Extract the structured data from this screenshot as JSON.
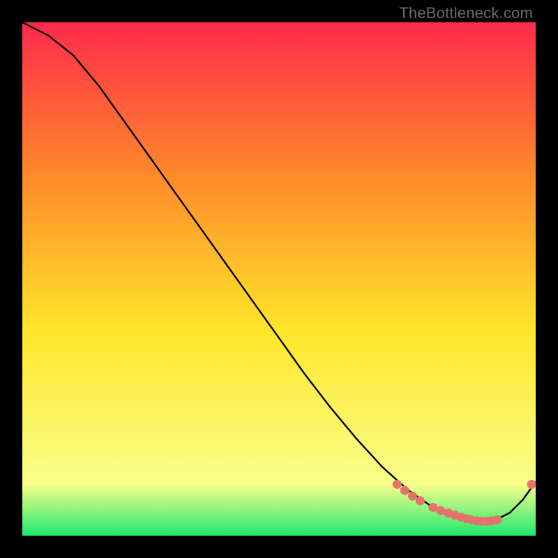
{
  "watermark": "TheBottleneck.com",
  "colors": {
    "grad_top": "#ff2a4b",
    "grad_mid_upper": "#ff8a2a",
    "grad_mid": "#ffe62a",
    "grad_lower": "#f8ff8a",
    "grad_bottom": "#1ee86f",
    "curve": "#000000",
    "marker": "#e2746b",
    "frame_bg": "#000000"
  },
  "chart_data": {
    "type": "line",
    "x": [
      0.0,
      0.05,
      0.1,
      0.15,
      0.2,
      0.25,
      0.3,
      0.35,
      0.4,
      0.45,
      0.5,
      0.55,
      0.6,
      0.65,
      0.7,
      0.75,
      0.8,
      0.825,
      0.85,
      0.875,
      0.9,
      0.925,
      0.95,
      0.975,
      1.0
    ],
    "values": [
      1.0,
      0.975,
      0.935,
      0.875,
      0.805,
      0.735,
      0.665,
      0.595,
      0.525,
      0.455,
      0.385,
      0.315,
      0.25,
      0.19,
      0.135,
      0.09,
      0.055,
      0.042,
      0.033,
      0.028,
      0.027,
      0.032,
      0.045,
      0.07,
      0.105
    ],
    "markers_x": [
      0.73,
      0.745,
      0.76,
      0.775,
      0.8,
      0.815,
      0.83,
      0.843,
      0.855,
      0.865,
      0.875,
      0.885,
      0.895,
      0.905,
      0.915,
      0.925,
      0.992
    ],
    "markers_y": [
      0.1,
      0.088,
      0.077,
      0.068,
      0.055,
      0.049,
      0.044,
      0.04,
      0.036,
      0.033,
      0.031,
      0.029,
      0.028,
      0.028,
      0.029,
      0.031,
      0.1
    ],
    "title": "",
    "xlabel": "",
    "ylabel": "",
    "xlim": [
      0,
      1
    ],
    "ylim": [
      0,
      1
    ],
    "grid": false
  }
}
